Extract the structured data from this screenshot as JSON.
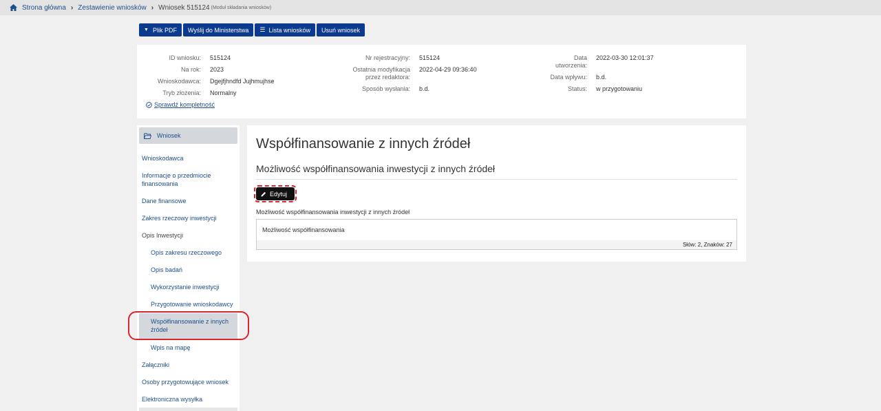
{
  "breadcrumb": {
    "home": "Strona główna",
    "list": "Zestawienie wniosków",
    "current": "Wniosek 515124",
    "current_sub": "(Moduł składania wniosków)"
  },
  "toolbar": {
    "pdf": "Plik PDF",
    "send": "Wyślij do Ministerstwa",
    "list": "Lista wniosków",
    "delete": "Usuń wniosek"
  },
  "info": {
    "col1": [
      {
        "k": "ID wniosku:",
        "v": "515124"
      },
      {
        "k": "Na rok:",
        "v": "2023"
      },
      {
        "k": "Wnioskodawca:",
        "v": "Dgejfjhndfd Jujhmujhse"
      },
      {
        "k": "Tryb złożenia:",
        "v": "Normalny"
      }
    ],
    "col2": [
      {
        "k": "Nr rejestracyjny:",
        "v": "515124"
      },
      {
        "k": "Ostatnia modyfikacja przez redaktora:",
        "v": "2022-04-29 09:36:40"
      },
      {
        "k": "Sposób wysłania:",
        "v": "b.d."
      }
    ],
    "col3": [
      {
        "k": "Data utworzenia:",
        "v": "2022-03-30 12:01:37"
      },
      {
        "k": "Data wpływu:",
        "v": "b.d."
      },
      {
        "k": "Status:",
        "v": "w przygotowaniu"
      }
    ],
    "check_link": "Sprawdź kompletność"
  },
  "sidebar": {
    "header": "Wniosek",
    "items": [
      {
        "label": "Wnioskodawca"
      },
      {
        "label": "Informacje o przedmiocie finansowania"
      },
      {
        "label": "Dane finansowe"
      },
      {
        "label": "Zakres rzeczowy inwestycji"
      },
      {
        "label": "Opis Inwestycji"
      },
      {
        "label": "Opis zakresu rzeczowego"
      },
      {
        "label": "Opis badań"
      },
      {
        "label": "Wykorzystanie inwestycji"
      },
      {
        "label": "Przygotowanie wnioskodawcy"
      },
      {
        "label": "Współfinansowanie z innych źródeł"
      },
      {
        "label": "Wpis na mapę"
      },
      {
        "label": "Załączniki"
      },
      {
        "label": "Osoby przygotowujące wniosek"
      },
      {
        "label": "Elektroniczna wysyłka"
      }
    ]
  },
  "main": {
    "title": "Współfinansowanie z innych źródeł",
    "subtitle": "Możliwość współfinansowania inwestycji z innych źródeł",
    "edit_label": "Edytuj",
    "field_label": "Możliwość współfinansowania inwestycji z innych źródeł",
    "field_value": "Możliwość współfinansowania",
    "counter": "Słów: 2, Znaków: 27"
  },
  "colors": {
    "accent": "#0b3a8e",
    "link": "#1e4e8c",
    "highlight": "#d8242f"
  }
}
